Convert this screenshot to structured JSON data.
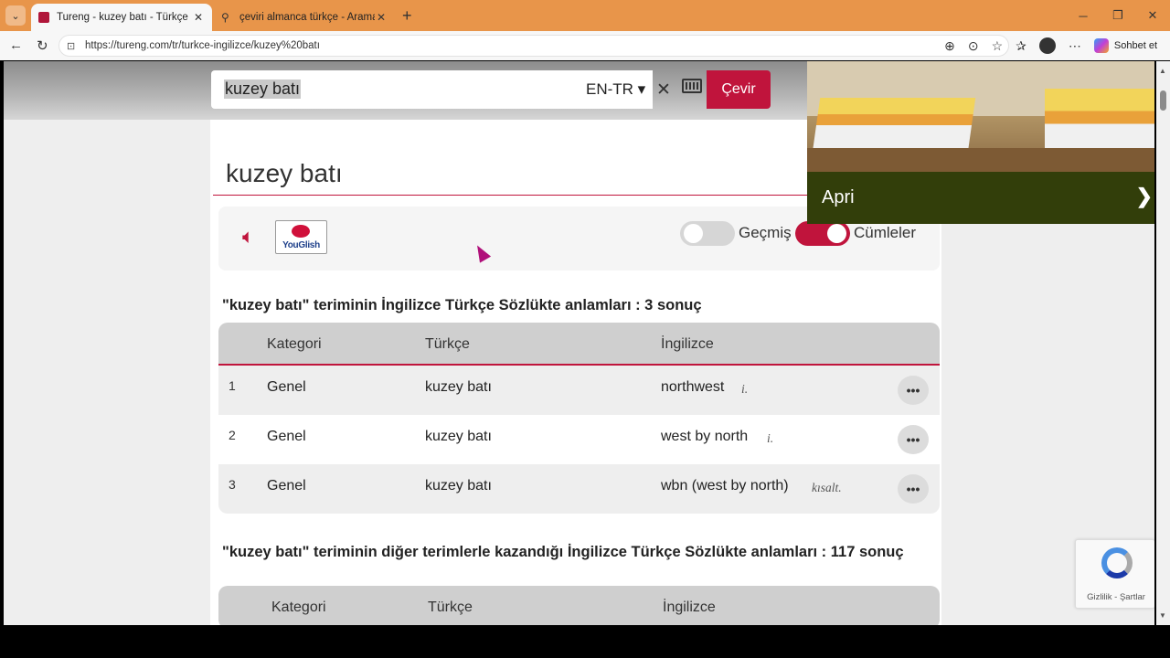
{
  "browser": {
    "tabs": [
      {
        "label": "Tureng - kuzey batı - Türkçe İngilizce Sözlük",
        "active": true
      },
      {
        "label": "çeviri almanca türkçe - Arama",
        "active": false
      }
    ],
    "url": "https://tureng.com/tr/turkce-ingilizce/kuzey%20batı",
    "sohbet_label": "Sohbet et"
  },
  "search": {
    "query": "kuzey batı",
    "language": "EN-TR",
    "translate_label": "Çevir"
  },
  "word_title": "kuzey batı",
  "tools": {
    "youglish_label": "YouGlish",
    "history_label": "Geçmiş",
    "sentences_label": "Cümleler"
  },
  "section1": {
    "heading": "\"kuzey batı\" teriminin İngilizce Türkçe Sözlükte anlamları : 3 sonuç",
    "columns": {
      "category": "Kategori",
      "turkish": "Türkçe",
      "english": "İngilizce"
    },
    "rows": [
      {
        "num": "1",
        "category": "Genel",
        "turkish": "kuzey batı",
        "english": "northwest",
        "type": "i."
      },
      {
        "num": "2",
        "category": "Genel",
        "turkish": "kuzey batı",
        "english": "west by north",
        "type": "i."
      },
      {
        "num": "3",
        "category": "Genel",
        "turkish": "kuzey batı",
        "english": "wbn (west by north)",
        "type": "kısalt."
      }
    ]
  },
  "section2": {
    "heading": "\"kuzey batı\" teriminin diğer terimlerle kazandığı İngilizce Türkçe Sözlükte anlamları : 117 sonuç",
    "columns": {
      "category": "Kategori",
      "turkish": "Türkçe",
      "english": "İngilizce"
    }
  },
  "ad": {
    "text": "Apri"
  },
  "recaptcha": {
    "text": "Gizlilik - Şartlar"
  },
  "colors": {
    "accent": "#c0143c",
    "tabbar": "#e8954a",
    "ad_bar": "#323e0a"
  }
}
